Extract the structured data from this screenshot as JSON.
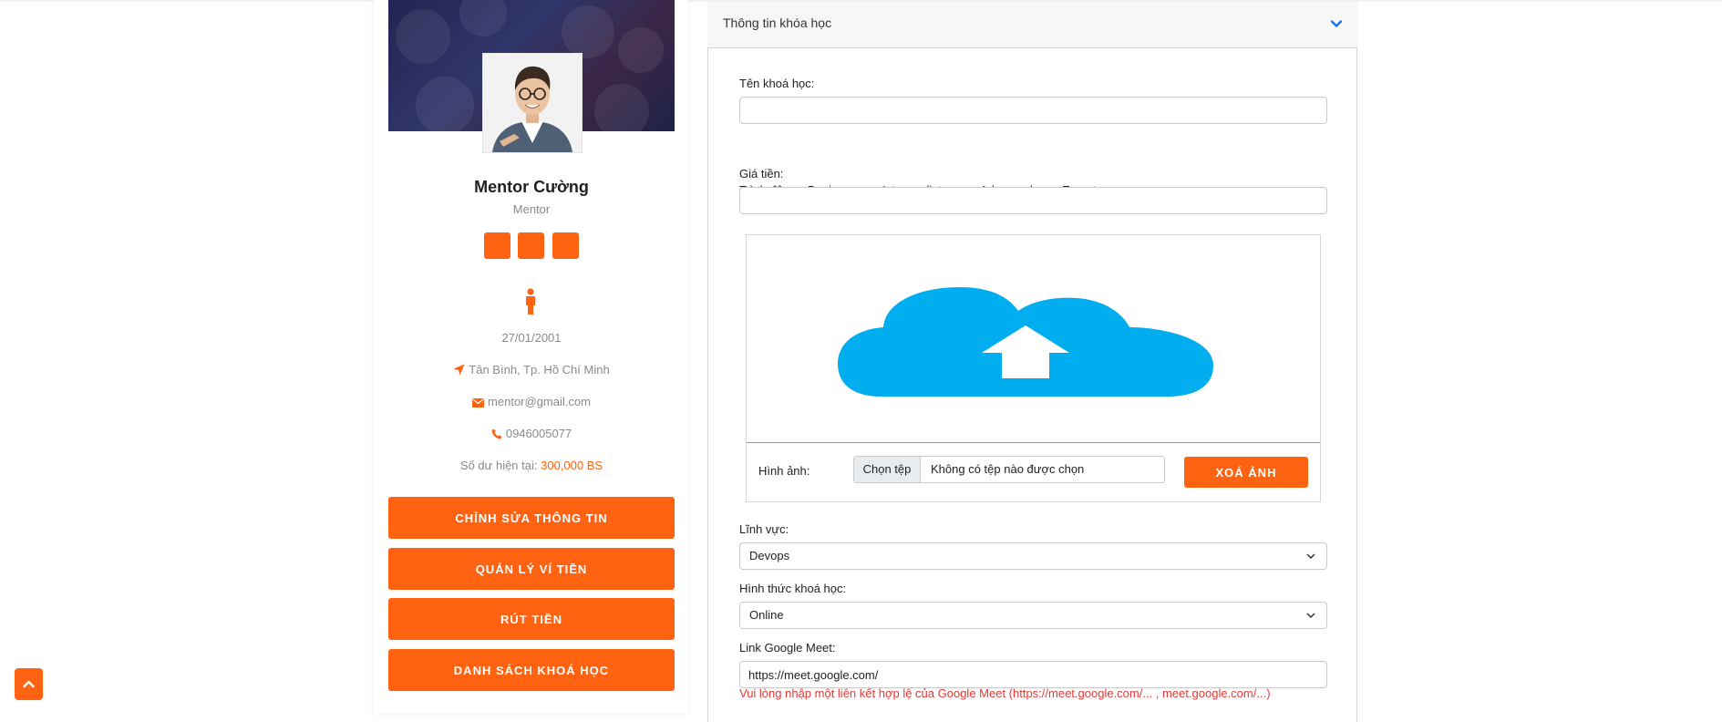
{
  "profile": {
    "name": "Mentor Cường",
    "role": "Mentor",
    "dob": "27/01/2001",
    "address": "Tân Bình, Tp. Hồ Chí Minh",
    "email": "mentor@gmail.com",
    "phone": "0946005077",
    "balance_label": "Số dư hiện tại:",
    "balance_value": "300,000 BS",
    "social_icons": [
      "social-icon",
      "social-icon",
      "social-icon"
    ],
    "gender_icon": "male-person-icon"
  },
  "actions": {
    "edit_info": "CHỈNH SỬA THÔNG TIN",
    "wallet": "QUẢN LÝ VÍ TIỀN",
    "withdraw": "RÚT TIỀN",
    "course_list": "DANH SÁCH KHOÁ HỌC"
  },
  "course_form": {
    "section_title": "Thông tin khóa học",
    "name_label": "Tên khoá học:",
    "name_value": "",
    "level_label": "Trình độ:",
    "levels": [
      "Beginner",
      "Intermediate",
      "Advanced",
      "Expert"
    ],
    "level_selected": "Intermediate",
    "price_label": "Giá tiền:",
    "price_value": "",
    "image_label": "Hình ảnh:",
    "file_button": "Chọn tệp",
    "file_status": "Không có tệp nào được chọn",
    "clear_image": "XOÁ ẢNH",
    "field_label": "Lĩnh vực:",
    "field_value": "Devops",
    "format_label": "Hình thức khoá học:",
    "format_value": "Online",
    "meet_label": "Link Google Meet:",
    "meet_value": "https://meet.google.com/",
    "meet_error": "Vui lòng nhập một liên kết hợp lệ của Google Meet (https://meet.google.com/... , meet.google.com/...)"
  },
  "colors": {
    "accent": "#ff6311",
    "cloud": "#00adef",
    "error": "#e53935",
    "radio_checked": "#1a73e8"
  }
}
